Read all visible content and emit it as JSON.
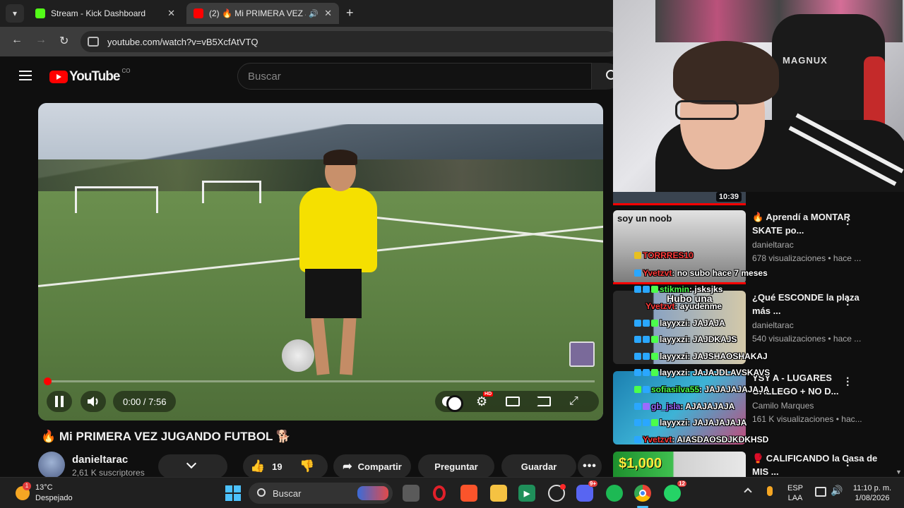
{
  "browser": {
    "tabs": [
      {
        "title": "Stream - Kick Dashboard",
        "favicon_color": "#53fc18",
        "active": false
      },
      {
        "title": "(2) 🔥 Mi PRIMERA VEZ JUG",
        "favicon_color": "#ff0000",
        "active": true
      }
    ],
    "url": "youtube.com/watch?v=vB5XcfAtVTQ"
  },
  "youtube": {
    "logo_text": "YouTube",
    "country_code": "CO",
    "search_placeholder": "Buscar",
    "player": {
      "time": "0:00 / 7:56",
      "progress": 0.0
    },
    "video_title": "🔥 Mi PRIMERA VEZ JUGANDO FUTBOL 🐕",
    "channel_name": "danieltarac",
    "subscribers": "2,61 K suscriptores",
    "likes": "19",
    "share_label": "Compartir",
    "ask_label": "Preguntar",
    "save_label": "Guardar"
  },
  "webcam": {
    "chair_brand": "MAGNUX"
  },
  "sidebar": {
    "first_duration": "10:39",
    "recs": [
      {
        "title": "🔥 Aprendí a MONTAR SKATE po...",
        "channel": "danieltarac",
        "meta": "678 visualizaciones • hace ...",
        "thumb_text": "soy un noob"
      },
      {
        "title": "¿Qué ESCONDE la plaza más ...",
        "channel": "danieltarac",
        "meta": "540 visualizaciones • hace ...",
        "thumb_text": ""
      },
      {
        "title": "YSY A - LUGARES GALLEGO + NO D...",
        "channel": "Camilo Marques",
        "meta": "161 K visualizaciones • hac...",
        "thumb_text": ""
      },
      {
        "title": "🥊 CALIFICANDO la Casa de MIS ...",
        "channel": "",
        "meta": "",
        "thumb_text": "$1,000"
      }
    ]
  },
  "chat": [
    {
      "user": "TORRRES10",
      "msg": "",
      "color": "#ff3b3b"
    },
    {
      "user": "Yvetzvt",
      "msg": ": no subo hace 7 meses",
      "color": "#ff3b3b"
    },
    {
      "user": "stikmin",
      "msg": ": jsksjks",
      "color": "#4cff4c"
    },
    {
      "user": "Yvetzvt",
      "msg": ": ayudenme",
      "color": "#ff3b3b"
    },
    {
      "user": "",
      "msg": "Hubo una",
      "color": "#ffffff"
    },
    {
      "user": "layyxzi",
      "msg": ": JAJAJA",
      "color": "#ffffff"
    },
    {
      "user": "layyxzi",
      "msg": ": JAJDKAJS",
      "color": "#ffffff"
    },
    {
      "user": "layyxzi",
      "msg": ": JAJSHAOSHAKAJ",
      "color": "#ffffff"
    },
    {
      "user": "layyxzi",
      "msg": ": JAJAJDLAVSKAVS",
      "color": "#ffffff"
    },
    {
      "user": "sofiasilva55",
      "msg": ": JAJAJAJAJAJA",
      "color": "#4cff4c"
    },
    {
      "user": "gb_jsla",
      "msg": ": AJAJAJAJA",
      "color": "#9b6bff"
    },
    {
      "user": "layyxzi",
      "msg": ": JAJAJAJAJA",
      "color": "#ffffff"
    },
    {
      "user": "Yvetzvt",
      "msg": ": AIASDAOSDJKDKHSD",
      "color": "#ff3b3b"
    }
  ],
  "taskbar": {
    "weather_temp": "13°C",
    "weather_desc": "Despejado",
    "weather_badge": "1",
    "search_label": "Buscar",
    "lang_top": "ESP",
    "lang_bottom": "LAA",
    "time": "11:10 p. m.",
    "date": "1/08/2026",
    "discord_badge": "9+",
    "whatsapp_badge": "12"
  }
}
